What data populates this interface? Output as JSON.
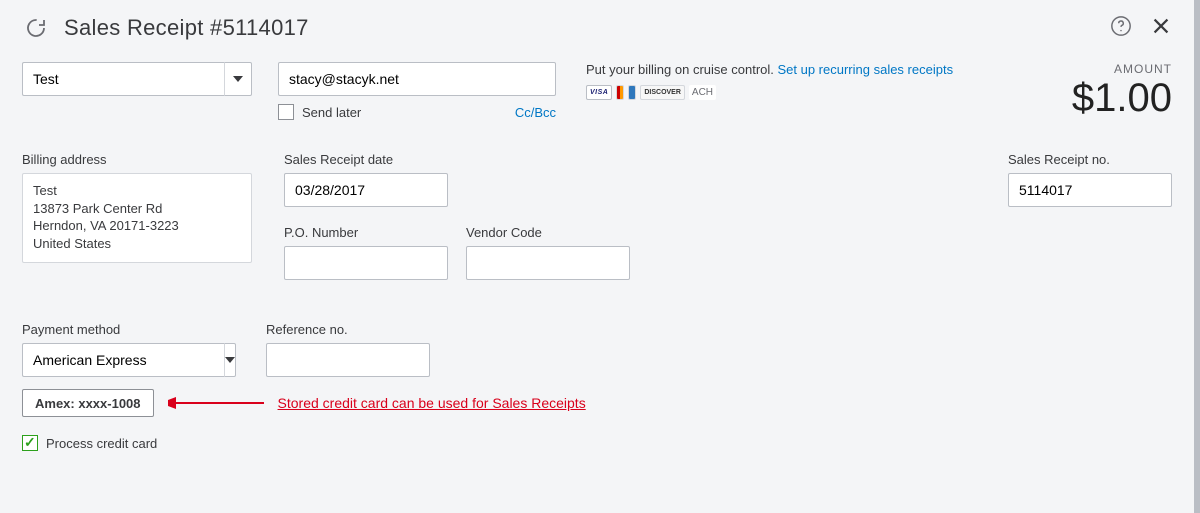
{
  "header": {
    "title": "Sales Receipt  #5114017"
  },
  "topRow": {
    "customer": "Test",
    "email": "stacy@stacyk.net",
    "sendLaterLabel": "Send later",
    "ccBccLabel": "Cc/Bcc"
  },
  "billingMsg": {
    "text": "Put your billing on cruise control. ",
    "linkText": "Set up recurring sales receipts"
  },
  "amount": {
    "label": "AMOUNT",
    "value": "$1.00"
  },
  "fields": {
    "billingAddressLabel": "Billing address",
    "billingAddress": "Test\n13873 Park Center Rd\nHerndon, VA  20171-3223\nUnited States",
    "dateLabel": "Sales Receipt date",
    "dateValue": "03/28/2017",
    "poLabel": "P.O. Number",
    "poValue": "",
    "vendorLabel": "Vendor Code",
    "vendorValue": "",
    "receiptNoLabel": "Sales Receipt no.",
    "receiptNoValue": "5114017"
  },
  "payment": {
    "methodLabel": "Payment method",
    "methodValue": "American Express",
    "refLabel": "Reference no.",
    "refValue": "",
    "storedCard": "Amex: xxxx-1008",
    "annotation": "Stored credit card can be used for Sales Receipts",
    "processLabel": "Process credit card"
  },
  "cards": {
    "visa": "VISA",
    "mc": "MasterCard",
    "amex": "AmEx",
    "disc": "DISCOVER",
    "ach": "ACH"
  }
}
